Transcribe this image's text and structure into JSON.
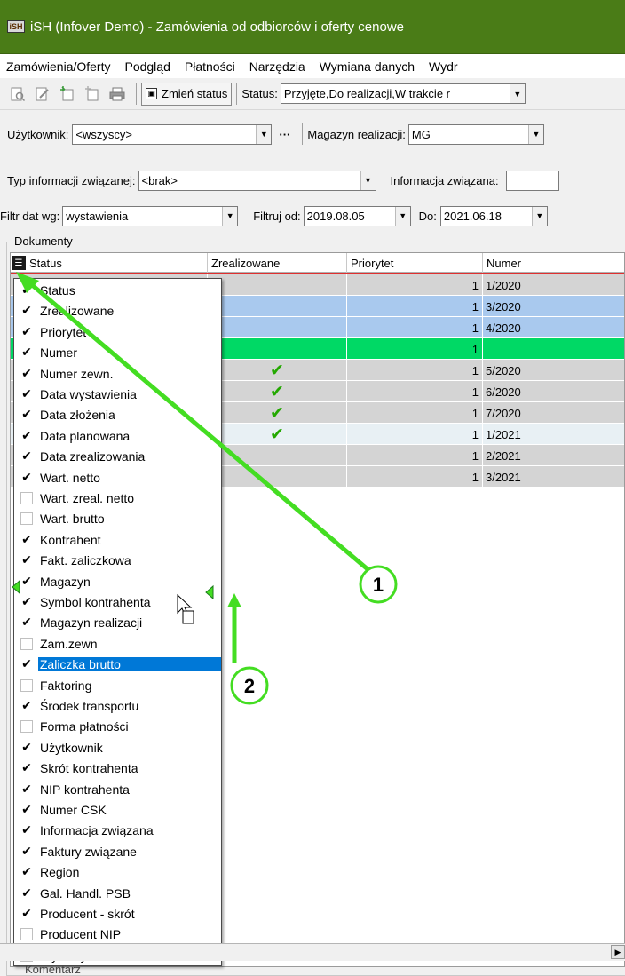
{
  "window": {
    "title": "iSH (Infover Demo) - Zamówienia od odbiorców i oferty cenowe",
    "app_icon_text": "iSH"
  },
  "menu": [
    "Zamówienia/Oferty",
    "Podgląd",
    "Płatności",
    "Narzędzia",
    "Wymiana danych",
    "Wydr"
  ],
  "toolbar": {
    "icons": [
      "search-doc-icon",
      "edit-icon",
      "new-doc-icon",
      "copy-doc-icon",
      "print-icon"
    ],
    "change_status_label": "Zmień status",
    "status_label": "Status:",
    "status_value": "Przyjęte,Do realizacji,W trakcie r"
  },
  "filters": {
    "user_label": "Użytkownik:",
    "user_value": "<wszyscy>",
    "ellipsis": "···",
    "warehouse_label": "Magazyn realizacji:",
    "warehouse_value": "MG",
    "info_type_label": "Typ informacji związanej:",
    "info_type_value": "<brak>",
    "info_label": "Informacja związana:",
    "date_filter_label": "Filtr dat wg:",
    "date_filter_value": "wystawienia",
    "from_label": "Filtruj od:",
    "from_value": "2019.08.05",
    "to_label": "Do:",
    "to_value": "2021.06.18"
  },
  "documents": {
    "group_label": "Dokumenty",
    "columns": [
      "Status",
      "Zrealizowane",
      "Priorytet",
      "Numer"
    ],
    "rows": [
      {
        "priorytet": "1",
        "numer": "1/2020",
        "zrealizowane": "",
        "color": "#d4d4d4"
      },
      {
        "priorytet": "1",
        "numer": "3/2020",
        "zrealizowane": "",
        "color": "#a9c9ee"
      },
      {
        "priorytet": "1",
        "numer": "4/2020",
        "zrealizowane": "",
        "color": "#a9c9ee"
      },
      {
        "priorytet": "1",
        "numer": "",
        "zrealizowane": "",
        "color": "#00d965"
      },
      {
        "priorytet": "1",
        "numer": "5/2020",
        "zrealizowane": "✔",
        "color": "#d4d4d4"
      },
      {
        "priorytet": "1",
        "numer": "6/2020",
        "zrealizowane": "✔",
        "color": "#d4d4d4"
      },
      {
        "priorytet": "1",
        "numer": "7/2020",
        "zrealizowane": "✔",
        "color": "#d4d4d4"
      },
      {
        "priorytet": "1",
        "numer": "1/2021",
        "zrealizowane": "✔",
        "color": "#e8f0f4"
      },
      {
        "priorytet": "1",
        "numer": "2/2021",
        "zrealizowane": "",
        "color": "#d4d4d4"
      },
      {
        "priorytet": "1",
        "numer": "3/2021",
        "zrealizowane": "",
        "color": "#d4d4d4"
      }
    ]
  },
  "column_chooser": {
    "items": [
      {
        "label": "Status",
        "checked": true
      },
      {
        "label": "Zrealizowane",
        "checked": true
      },
      {
        "label": "Priorytet",
        "checked": true
      },
      {
        "label": "Numer",
        "checked": true
      },
      {
        "label": "Numer zewn.",
        "checked": true
      },
      {
        "label": "Data wystawienia",
        "checked": true
      },
      {
        "label": "Data złożenia",
        "checked": true
      },
      {
        "label": "Data planowana",
        "checked": true
      },
      {
        "label": "Data zrealizowania",
        "checked": true
      },
      {
        "label": "Wart. netto",
        "checked": true
      },
      {
        "label": "Wart. zreal. netto",
        "checked": false
      },
      {
        "label": "Wart. brutto",
        "checked": false
      },
      {
        "label": "Kontrahent",
        "checked": true
      },
      {
        "label": "Fakt. zaliczkowa",
        "checked": true
      },
      {
        "label": "Magazyn",
        "checked": true
      },
      {
        "label": "Symbol kontrahenta",
        "checked": true
      },
      {
        "label": "Magazyn realizacji",
        "checked": true
      },
      {
        "label": "Zam.zewn",
        "checked": false
      },
      {
        "label": "Zaliczka brutto",
        "checked": true,
        "selected": true
      },
      {
        "label": "Faktoring",
        "checked": false
      },
      {
        "label": "Środek transportu",
        "checked": true
      },
      {
        "label": "Forma płatności",
        "checked": false
      },
      {
        "label": "Użytkownik",
        "checked": true
      },
      {
        "label": "Skrót kontrahenta",
        "checked": true
      },
      {
        "label": "NIP kontrahenta",
        "checked": true
      },
      {
        "label": "Numer CSK",
        "checked": true
      },
      {
        "label": "Informacja związana",
        "checked": true
      },
      {
        "label": "Faktury związane",
        "checked": true
      },
      {
        "label": "Region",
        "checked": true
      },
      {
        "label": "Gal. Handl. PSB",
        "checked": true
      },
      {
        "label": "Producent - skrót",
        "checked": true
      },
      {
        "label": "Producent NIP",
        "checked": false
      },
      {
        "label": "Wysłany do eDokumentów",
        "checked": false
      }
    ]
  },
  "annotations": {
    "callout_1": "1",
    "callout_2": "2",
    "accent_color": "#44dd22"
  },
  "footer": {
    "label": "Komentarz"
  }
}
